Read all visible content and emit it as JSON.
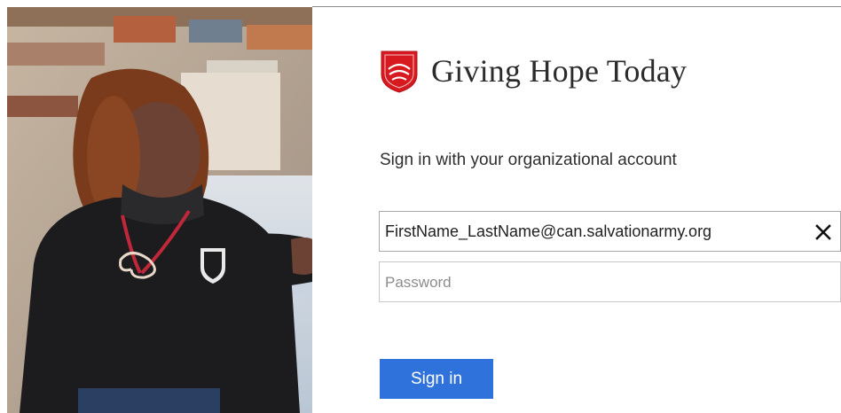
{
  "brand": {
    "title": "Giving Hope Today",
    "logo_icon": "salvation-army-shield-icon",
    "logo_color": "#d71920"
  },
  "signin": {
    "prompt": "Sign in with your organizational account",
    "email_value": "FirstName_LastName@can.salvationarmy.org",
    "password_placeholder": "Password",
    "clear_icon": "close-icon",
    "button_label": "Sign in",
    "button_color": "#2f72db"
  },
  "illustration": {
    "subject": "woman-in-black-fleece-with-lanyard"
  }
}
